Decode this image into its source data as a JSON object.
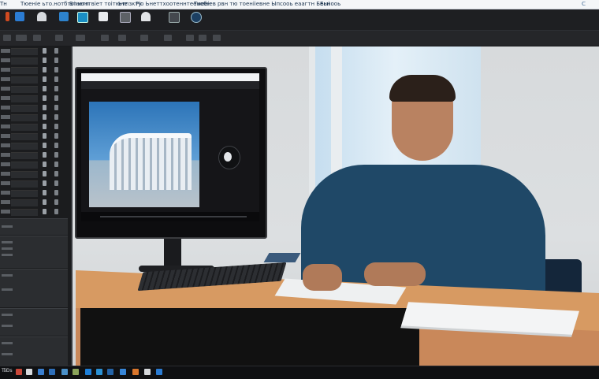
{
  "titlebar": {
    "segments": [
      "Тн",
      "Тюеніе ьто.нотбтоінегп",
      "Бтаюнтвіет тоітюне",
      "Ьтпзкту",
      "Ріо Ьнеттхоотеннтеенобн",
      "Тиееіев рвн тю тоенііевне Ыпсооь еаагтн Беннооь",
      "Быі"
    ],
    "right_glyph": "ᑕ"
  },
  "ribbon": {
    "buttons": [
      {
        "label": "",
        "icon": "app-icon"
      },
      {
        "label": "",
        "icon": "project-icon"
      },
      {
        "label": "",
        "icon": "person-icon"
      },
      {
        "label": "",
        "icon": "file-icon"
      },
      {
        "label": "",
        "icon": "monitor-icon"
      },
      {
        "label": "",
        "icon": "bookmark-icon"
      },
      {
        "label": "",
        "icon": "camera-icon"
      },
      {
        "label": "",
        "icon": "user-icon"
      },
      {
        "label": "",
        "icon": "panel-icon"
      },
      {
        "label": "",
        "icon": "globe-icon"
      }
    ]
  },
  "taskbar": {
    "start_label": "TšĐs",
    "apps": [
      "explorer-icon",
      "store-icon",
      "mail-icon",
      "photos-icon",
      "folder-icon",
      "browser-icon",
      "settings-icon",
      "media-icon",
      "terminal-icon",
      "mail-icon",
      "folder-icon",
      "app-icon"
    ]
  },
  "colors": {
    "accent": "#2b7cd3",
    "shirt": "#1f4867",
    "desk": "#d79a62"
  }
}
